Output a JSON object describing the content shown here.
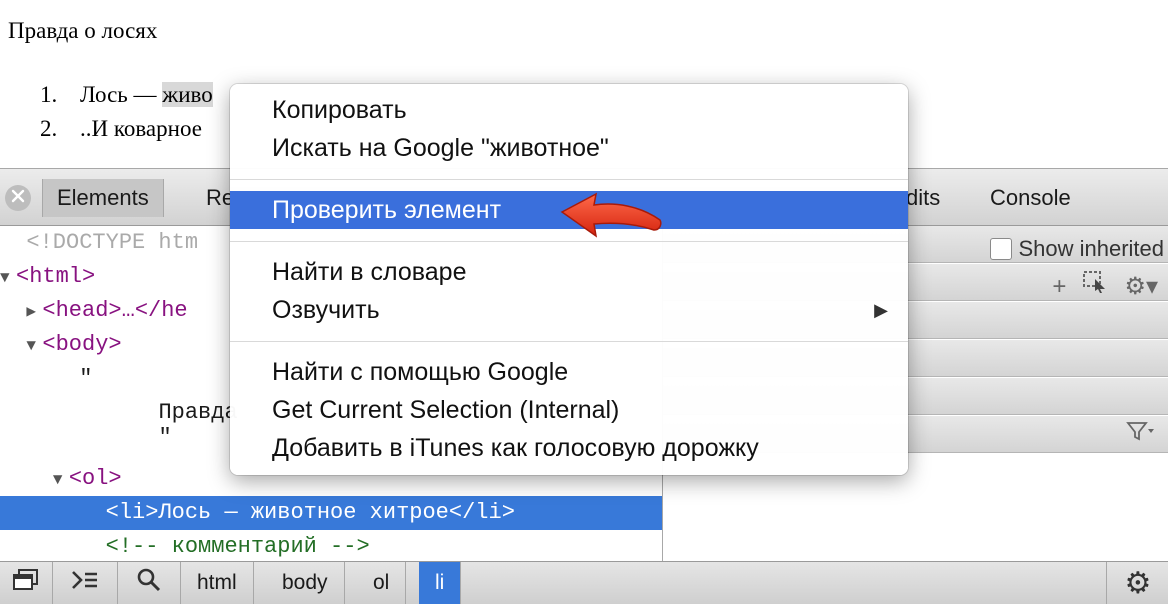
{
  "page": {
    "heading": "Правда о лосях",
    "list": [
      {
        "num": "1.",
        "before": "Лось — ",
        "highlight": "живо",
        "after": ""
      },
      {
        "num": "2.",
        "before": "..И коварное",
        "highlight": "",
        "after": ""
      }
    ]
  },
  "devtools": {
    "tabs": [
      {
        "label": "Elements",
        "active": true
      },
      {
        "label": "Re",
        "active": false
      },
      {
        "label": "dits",
        "active": false
      },
      {
        "label": "Console",
        "active": false
      }
    ],
    "dom_lines": [
      {
        "indent": "  ",
        "tri": "",
        "html": "doctype",
        "text": "<!DOCTYPE htm"
      },
      {
        "indent": "",
        "tri": "▼",
        "tag": "<html>"
      },
      {
        "indent": "  ",
        "tri": "▶",
        "tag": "<head>…</he"
      },
      {
        "indent": "  ",
        "tri": "▼",
        "tag": "<body>"
      },
      {
        "text1": "\"",
        "text2": "Правда",
        "text3": "\""
      },
      {
        "indent": "    ",
        "tri": "▼",
        "tag": "<ol>"
      },
      {
        "selected_text": "<li>Лось — животное хитрое</li>"
      },
      {
        "comment": "<!-- комментарий -->"
      }
    ],
    "show_inherited_label": "Show inherited",
    "breadcrumbs": [
      "html",
      "body",
      "ol",
      "li"
    ],
    "active_crumb": "li"
  },
  "context_menu": {
    "items": [
      {
        "label": "Копировать"
      },
      {
        "label": "Искать на Google \"животное\""
      },
      {
        "label": "Проверить элемент",
        "highlighted": true
      },
      {
        "label": "Найти в словаре"
      },
      {
        "label": "Озвучить",
        "submenu": true
      },
      {
        "label": "Найти с помощью Google"
      },
      {
        "label": "Get Current Selection (Internal)"
      },
      {
        "label": "Добавить в iTunes как голосовую дорожку"
      }
    ]
  },
  "colors": {
    "selection_blue": "#3879d9",
    "menu_highlight": "#3a6fdc",
    "annotation_red": "#e8321e",
    "tag_purple": "#881280",
    "comment_green": "#236e25"
  },
  "icons": [
    "close-icon",
    "dock-icon",
    "console-drawer-icon",
    "search-icon",
    "add-icon",
    "element-state-icon",
    "gear-icon",
    "filter-icon",
    "submenu-arrow-icon"
  ]
}
